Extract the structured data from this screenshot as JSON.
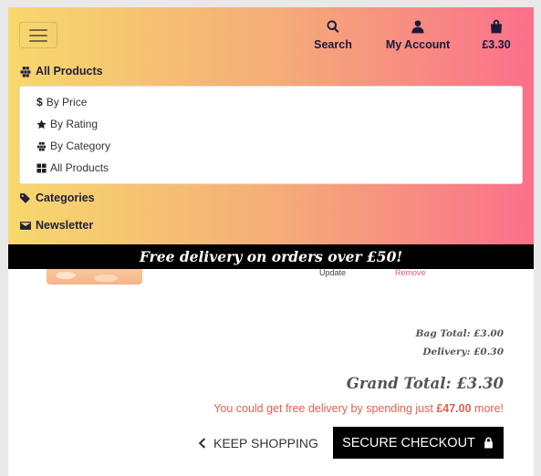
{
  "header": {
    "search_label": "Search",
    "account_label": "My Account",
    "cart_label": "£3.30",
    "icons": [
      "menu-icon",
      "search-icon",
      "user-icon",
      "shopping-bag-icon"
    ]
  },
  "nav": {
    "all_products_title": "All Products",
    "dropdown": [
      {
        "label": "By Price",
        "icon": "dollar-icon"
      },
      {
        "label": "By Rating",
        "icon": "star-icon"
      },
      {
        "label": "By Category",
        "icon": "cubes-icon"
      },
      {
        "label": "All Products",
        "icon": "grid-icon"
      }
    ],
    "categories_title": "Categories",
    "newsletter_title": "Newsletter"
  },
  "promo": {
    "text": "Free delivery on orders over £50!"
  },
  "cart_row": {
    "update_label": "Update",
    "remove_label": "Remove"
  },
  "totals": {
    "bag_total": "Bag Total: £3.00",
    "delivery": "Delivery: £0.30",
    "grand_total": "Grand Total: £3.30",
    "free_delivery_prefix": "You could get free delivery by spending just ",
    "free_delivery_amount": "£47.00",
    "free_delivery_suffix": " more!"
  },
  "actions": {
    "keep_shopping_label": "KEEP SHOPPING",
    "checkout_label": "SECURE CHECKOUT"
  },
  "colors": {
    "gradient_start": "#f7d86d",
    "gradient_mid": "#f4ae78",
    "gradient_end": "#fb6f8b",
    "accent_red": "#e8604c",
    "remove_pink": "#e35b76"
  }
}
